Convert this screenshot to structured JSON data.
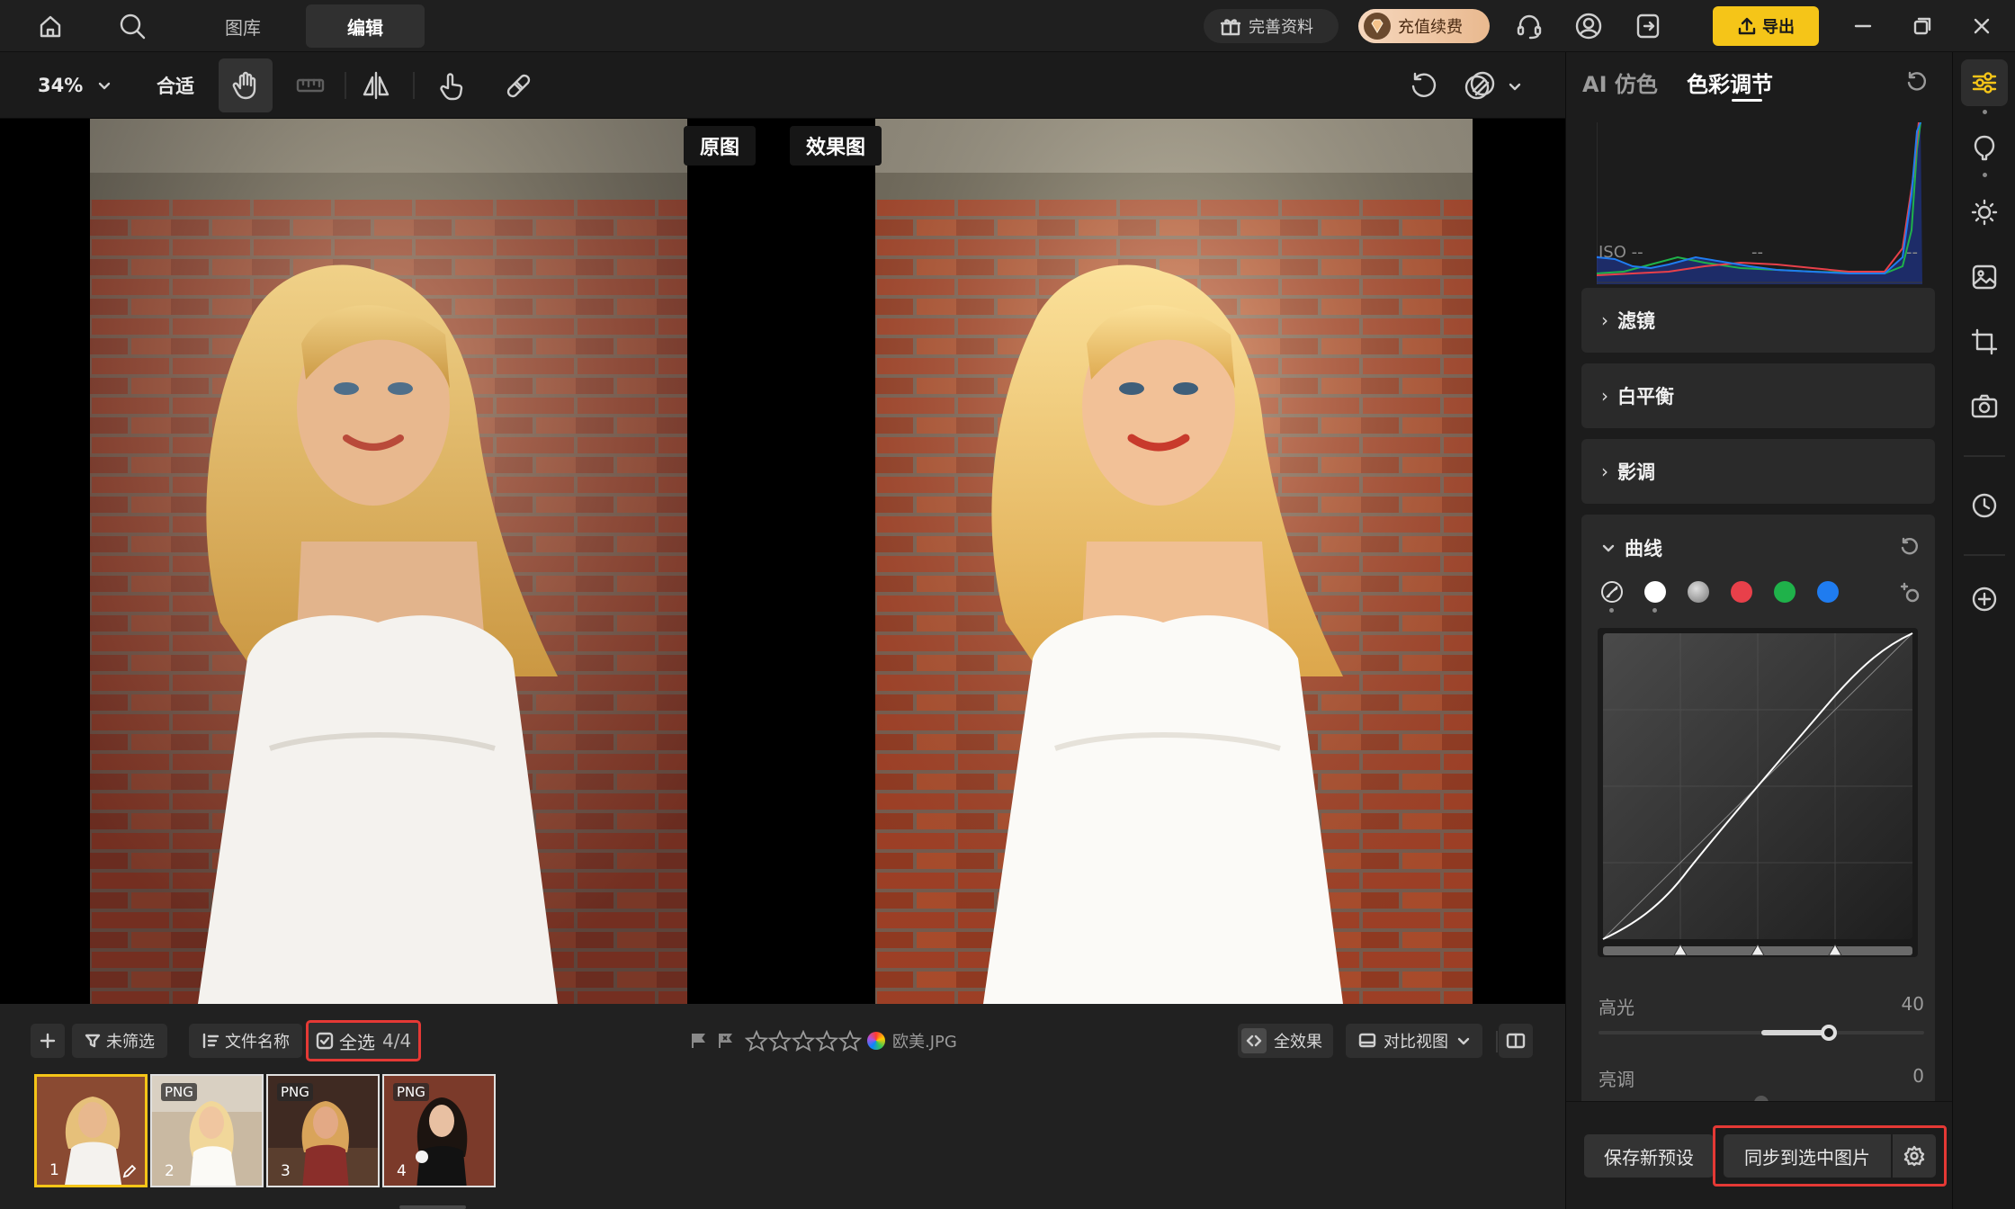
{
  "topbar": {
    "tabs": [
      {
        "label": "图库",
        "active": false
      },
      {
        "label": "编辑",
        "active": true
      }
    ],
    "complete_profile": "完善资料",
    "recharge": "充值续费",
    "export": "导出"
  },
  "toolbar": {
    "zoom": "34%",
    "fit": "合适"
  },
  "canvas": {
    "label_original": "原图",
    "label_effect": "效果图"
  },
  "filmstrip": {
    "filter": "未筛选",
    "sort": "文件名称",
    "select_all": "全选",
    "select_count": "4/4",
    "filename": "欧美.JPG",
    "all_effects": "全效果",
    "compare_view": "对比视图",
    "thumbs": [
      {
        "num": "1",
        "badge": ""
      },
      {
        "num": "2",
        "badge": "PNG"
      },
      {
        "num": "3",
        "badge": "PNG"
      },
      {
        "num": "4",
        "badge": "PNG"
      }
    ]
  },
  "panel": {
    "tab_ai": "AI 仿色",
    "tab_color": "色彩调节",
    "iso": "ISO --",
    "exif_mid": "--",
    "exif_right": "--",
    "sections": [
      {
        "label": "滤镜"
      },
      {
        "label": "白平衡"
      },
      {
        "label": "影调"
      }
    ],
    "curve_label": "曲线",
    "sliders": [
      {
        "label": "高光",
        "value": "40",
        "fraction": 0.7
      },
      {
        "label": "亮调",
        "value": "0",
        "fraction": 0.5
      }
    ],
    "save_preset": "保存新预设",
    "sync_selected": "同步到选中图片"
  },
  "colors": {
    "accent": "#f5c518",
    "highlight_border": "#e53935",
    "curve_red": "#e8404a",
    "curve_green": "#1fb24a",
    "curve_blue": "#1f7cf0"
  }
}
